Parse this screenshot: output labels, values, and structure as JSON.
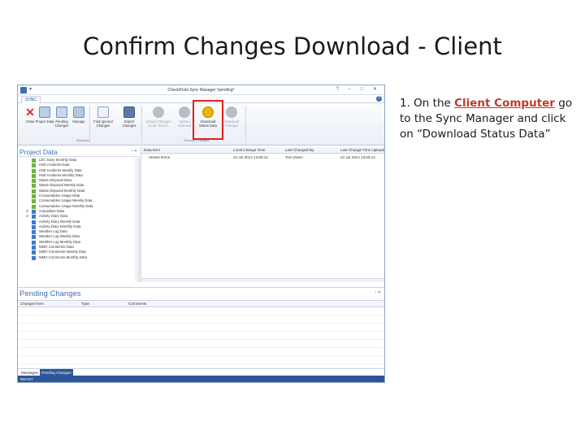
{
  "slide": {
    "title": "Confirm Changes Download - Client",
    "instruction_prefix": "1. On the ",
    "instruction_highlight": "Client Computer",
    "instruction_suffix": " go to the Sync Manager and click on “Download Status Data”"
  },
  "app": {
    "window_title": "CheckPoint Sync Manager *pending*",
    "window_controls": "? – □ ✕",
    "ribbon_tab": "SYNC",
    "help_label": "?",
    "ribbon": {
      "close": "Close",
      "project_data": "Project Data",
      "pending_changes": "Pending Changes",
      "manage": "Manage",
      "find_ignored_changes": "Find Ignored Changes",
      "export_changes": "Export Changes",
      "upload_changes": "Upload Changes to the Server",
      "upload_selected": "Upload Selected",
      "download_status_data": "Download Status Data",
      "download_changes": "Download Changes",
      "group_windows": "Windows",
      "group_remote": "Remote Changes"
    },
    "project_data_title": "Project Data",
    "pin_label": "↕ ✕",
    "tree_items": [
      {
        "label": "LEC Diary Monthly Data",
        "color": "green"
      },
      {
        "label": "HSE Incidents Data",
        "color": "green"
      },
      {
        "label": "HSE Incidents Weekly Data",
        "color": "green"
      },
      {
        "label": "HSE Incidents Monthly Data",
        "color": "green"
      },
      {
        "label": "Waste Disposal Data",
        "color": "green"
      },
      {
        "label": "Waste Disposal Weekly Data",
        "color": "green"
      },
      {
        "label": "Waste Disposal Monthly Data",
        "color": "green"
      },
      {
        "label": "Consumables Usage Data",
        "color": "green"
      },
      {
        "label": "Consumables Usage Weekly Data",
        "color": "green"
      },
      {
        "label": "Consumables Usage Monthly Data",
        "color": "green"
      },
      {
        "label": "Acquisition Data",
        "color": "blue",
        "expander": "⊞"
      },
      {
        "label": "Activity Diary Data",
        "color": "blue",
        "expander": "⊞"
      },
      {
        "label": "Activity Diary Weekly Data",
        "color": "blue"
      },
      {
        "label": "Activity Diary Monthly Data",
        "color": "blue"
      },
      {
        "label": "Weather Log Data",
        "color": "blue"
      },
      {
        "label": "Weather Log Weekly Data",
        "color": "blue"
      },
      {
        "label": "Weather Log Monthly Data",
        "color": "blue"
      },
      {
        "label": "MMO Comments Data",
        "color": "blue"
      },
      {
        "label": "MMO Comments Weekly Data",
        "color": "blue"
      },
      {
        "label": "MMO Comments Monthly Data",
        "color": "blue"
      }
    ],
    "grid_columns": [
      "Data Item",
      "Local Change Time",
      "Last Changed By",
      "Last Change Time Uploaded"
    ],
    "grid_rows": [
      [
        "Vessel Items",
        "24 Jul 2014 13:59:12",
        "Tom Owen",
        "24 Jul 2014 13:58:12"
      ]
    ],
    "pending_changes_title": "Pending Changes",
    "pending_columns": [
      "Changed Item",
      "Type",
      "Comments"
    ],
    "bottom_tabs": [
      "Messages",
      "Pending Changes"
    ],
    "status": "READY"
  },
  "colors": {
    "accent": "#3b6fb6",
    "highlight_box": "#e11d1d",
    "status_bar": "#2b579a",
    "download_icon": "#f2b500"
  }
}
